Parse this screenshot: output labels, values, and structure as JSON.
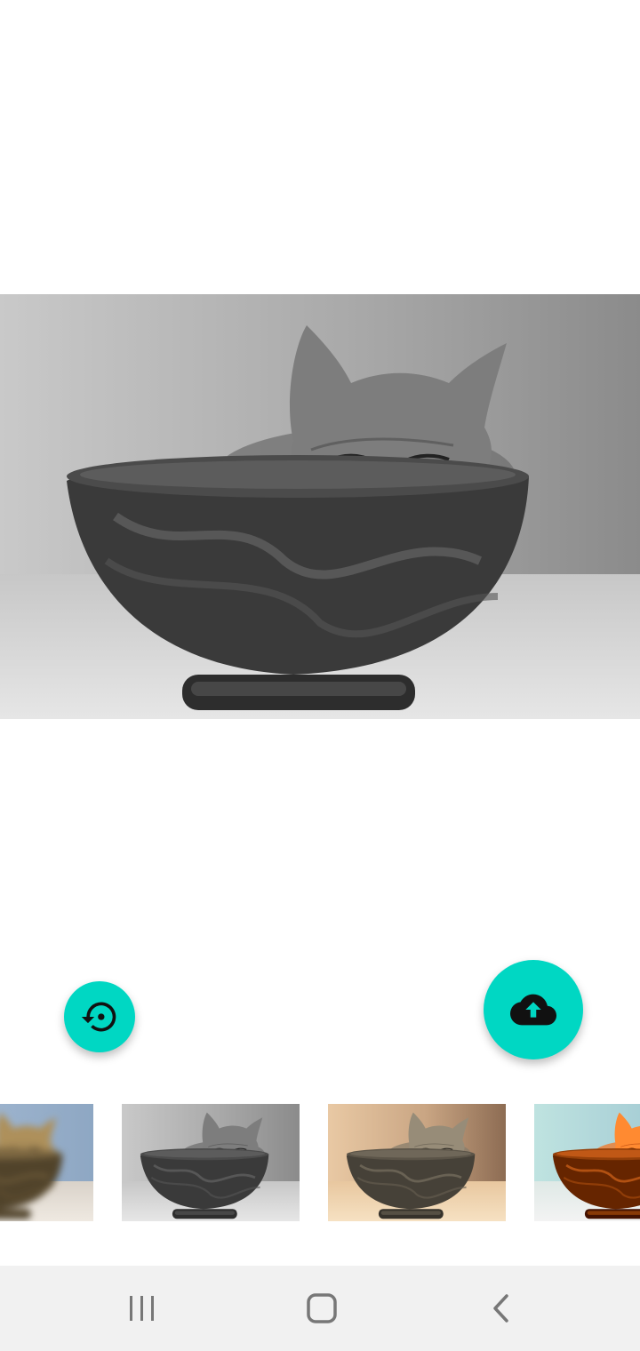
{
  "editor": {
    "preview_filter": "grayscale",
    "thumbnails": [
      "blur",
      "grayscale",
      "sepia",
      "posterize"
    ]
  },
  "actions": {
    "accent_color": "#00d7c3",
    "restore_icon": "restore-icon",
    "upload_icon": "cloud-upload-icon"
  },
  "navigation": {
    "recent_icon": "recent-apps-icon",
    "home_icon": "home-icon",
    "back_icon": "back-icon"
  }
}
